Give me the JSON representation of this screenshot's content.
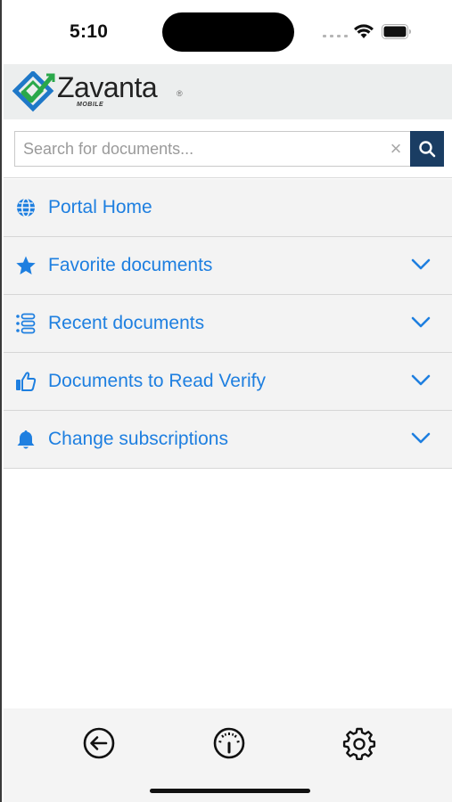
{
  "status_bar": {
    "time": "5:10"
  },
  "header": {
    "brand": "Zavanta",
    "brand_sub": "MOBILE",
    "registered_mark": "®",
    "icon": "zavanta-logo"
  },
  "search": {
    "placeholder": "Search for documents...",
    "value": "",
    "clear_symbol": "×",
    "clear_icon": "close-icon",
    "submit_icon": "search-icon"
  },
  "menu": {
    "items": [
      {
        "label": "Portal Home",
        "icon": "globe-icon",
        "expandable": false
      },
      {
        "label": "Favorite documents",
        "icon": "star-icon",
        "expandable": true
      },
      {
        "label": "Recent documents",
        "icon": "list-icon",
        "expandable": true
      },
      {
        "label": "Documents to Read Verify",
        "icon": "thumbs-up-icon",
        "expandable": true
      },
      {
        "label": "Change subscriptions",
        "icon": "bell-icon",
        "expandable": true
      }
    ]
  },
  "bottom_bar": {
    "tabs": [
      {
        "icon": "back-arrow-icon"
      },
      {
        "icon": "dashboard-gauge-icon"
      },
      {
        "icon": "settings-gear-icon"
      }
    ]
  },
  "colors": {
    "accent": "#1e7fe0",
    "search_button": "#1a3d63",
    "header_bg": "#eceeee",
    "menu_bg": "#f3f3f3",
    "logo_green": "#2aa84a",
    "logo_blue": "#1f78c8"
  }
}
